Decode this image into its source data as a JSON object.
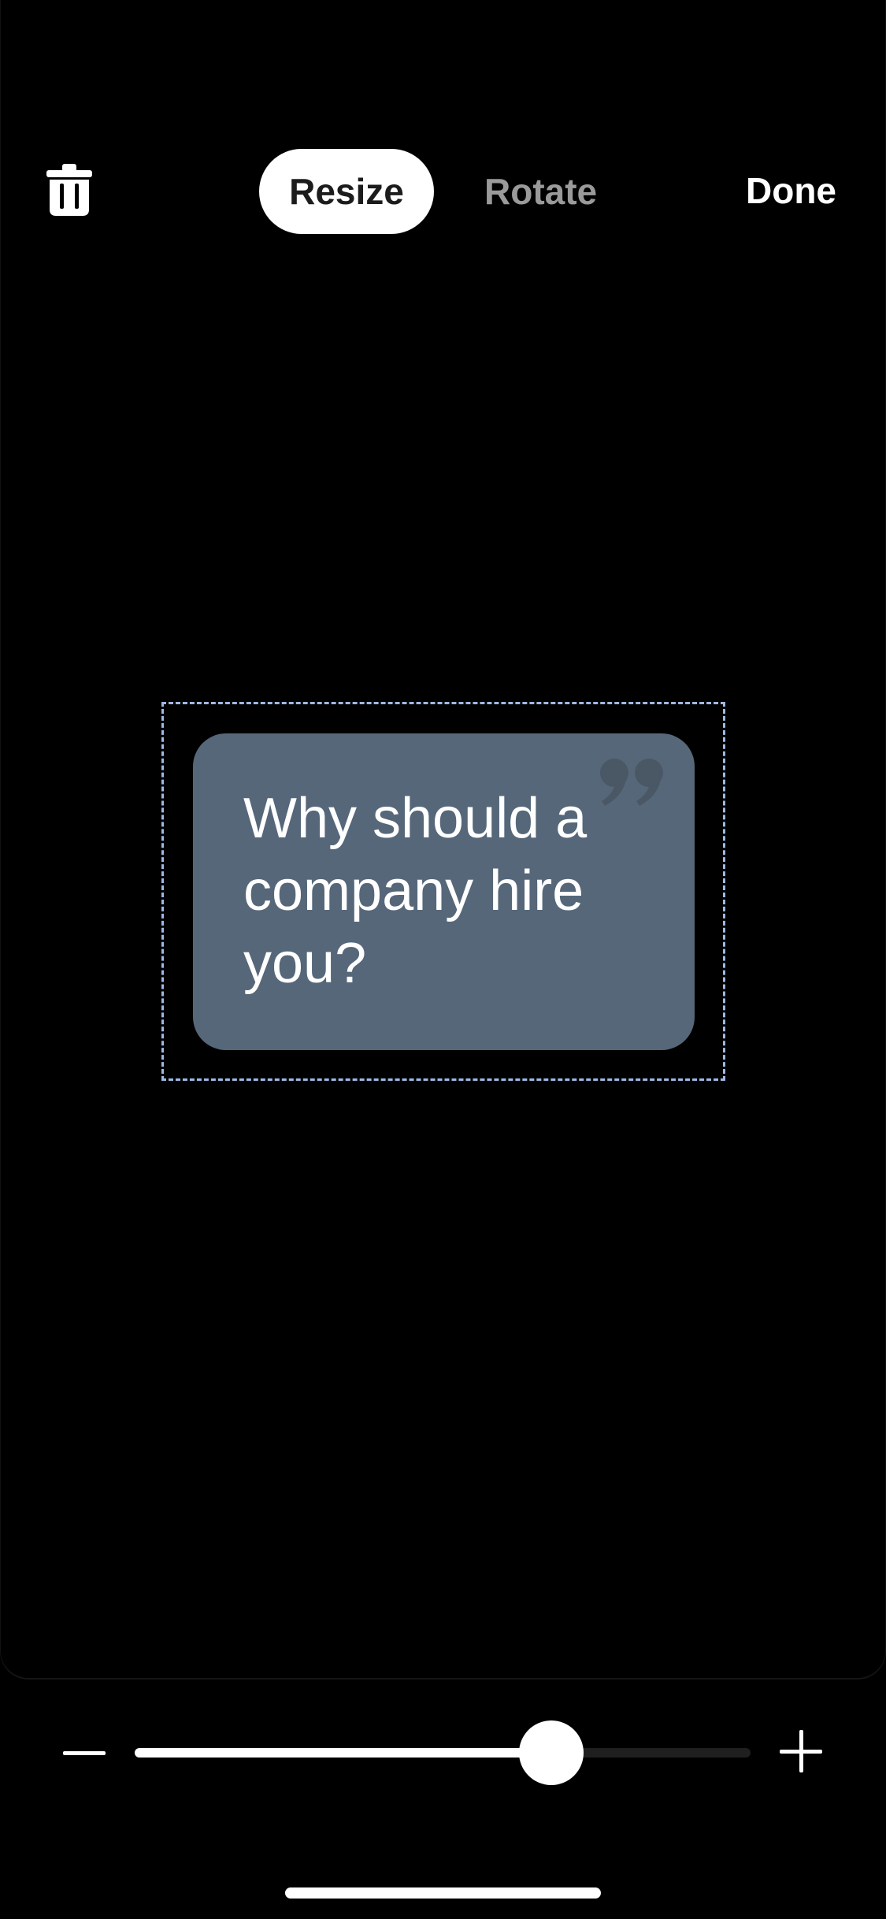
{
  "toolbar": {
    "delete_icon": "trash-icon",
    "modes": [
      {
        "label": "Resize",
        "active": true
      },
      {
        "label": "Rotate",
        "active": false
      }
    ],
    "done_label": "Done"
  },
  "sticker": {
    "text": "Why should a company hire you?",
    "card_color": "#56677a",
    "quote_icon": "closing-quote-icon",
    "selection_color": "#9fb8e6"
  },
  "slider": {
    "decrease_icon": "minus-icon",
    "increase_icon": "plus-icon",
    "value_fraction": 0.676
  }
}
